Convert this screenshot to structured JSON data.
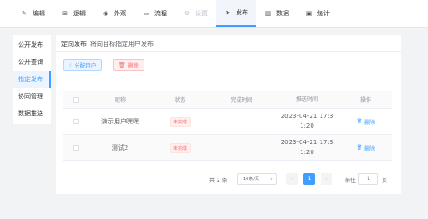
{
  "nav": {
    "tabs": [
      {
        "icon": "edit-icon",
        "glyph": "✎",
        "label": "编辑"
      },
      {
        "icon": "logic-icon",
        "glyph": "⊞",
        "label": "逻辑"
      },
      {
        "icon": "eye-icon",
        "glyph": "◉",
        "label": "外观"
      },
      {
        "icon": "flow-icon",
        "glyph": "▭",
        "label": "流程"
      },
      {
        "icon": "gear-icon",
        "glyph": "⚙",
        "label": "设置"
      },
      {
        "icon": "send-icon",
        "glyph": "➤",
        "label": "发布"
      },
      {
        "icon": "bar-chart-icon",
        "glyph": "▥",
        "label": "数据"
      },
      {
        "icon": "stats-icon",
        "glyph": "▣",
        "label": "统计"
      }
    ],
    "active_index": 5
  },
  "submenu": {
    "items": [
      "公开发布",
      "公开查询",
      "指定发布",
      "协同管理",
      "数据推送"
    ],
    "active_index": 2
  },
  "panel": {
    "title": "定向发布",
    "description": "将向目标指定用户发布",
    "assign_button": "分配用户",
    "delete_button": "删除"
  },
  "table": {
    "columns": [
      "昵称",
      "状态",
      "完成时间",
      "推送时间",
      "操作"
    ],
    "rows": [
      {
        "name": "演示用户嘿嘿",
        "status": "未完成",
        "finish_time": "",
        "push_time_line1": "2023-04-21 17:3",
        "push_time_line2": "1:20",
        "op": "删除"
      },
      {
        "name": "测试2",
        "status": "未完成",
        "finish_time": "",
        "push_time_line1": "2023-04-21 17:3",
        "push_time_line2": "1:20",
        "op": "删除"
      }
    ]
  },
  "pagination": {
    "total_text": "共 2 条",
    "page_size": "10条/页",
    "current_page": "1",
    "goto_label": "前往",
    "goto_value": "1",
    "goto_suffix": "页"
  },
  "colors": {
    "accent": "#409eff",
    "danger": "#f56c6c",
    "background": "#f2f3f5"
  }
}
